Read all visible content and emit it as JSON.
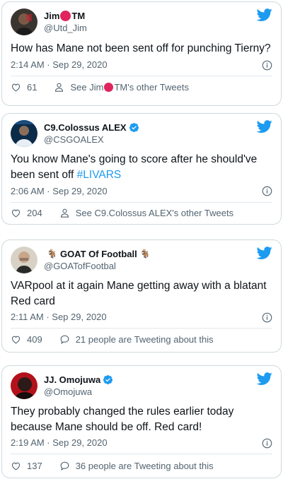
{
  "colors": {
    "twitter_blue": "#1d9bf0",
    "text_primary": "#0f1419",
    "text_secondary": "#536471",
    "border": "#cfd9de",
    "red_dot": "#e0245e"
  },
  "tweets": [
    {
      "name_part1": "Jim",
      "name_part2": "TM",
      "handle": "@Utd_Jim",
      "text": "How has Mane not been sent off for punching Tierny?",
      "timestamp": "2:14 AM · Sep 29, 2020",
      "like_count": "61",
      "more_link_part1": "See Jim",
      "more_link_part2": "TM's other Tweets",
      "icons": [
        "twitter-bird-icon",
        "info-icon",
        "heart-icon",
        "person-icon"
      ]
    },
    {
      "name": "C9.Colossus ALEX",
      "handle": "@CSGOALEX",
      "verified": true,
      "text_before_hashtag": "You know Mane's going to score after he should've been sent off ",
      "hashtag": "#LIVARS",
      "timestamp": "2:06 AM · Sep 29, 2020",
      "like_count": "204",
      "more_link": "See C9.Colossus ALEX's other Tweets",
      "icons": [
        "twitter-bird-icon",
        "verified-badge-icon",
        "info-icon",
        "heart-icon",
        "person-icon"
      ]
    },
    {
      "name": "GOAT Of Football",
      "name_prefix_emoji": "🐐",
      "name_suffix_emoji": "🐐",
      "handle": "@GOATofFootbal",
      "text": "VARpool at it again Mane getting away with a blatant Red card",
      "timestamp": "2:11 AM · Sep 29, 2020",
      "like_count": "409",
      "more_link": "21 people are Tweeting about this",
      "icons": [
        "twitter-bird-icon",
        "info-icon",
        "heart-icon",
        "speech-bubble-icon"
      ]
    },
    {
      "name": "JJ. Omojuwa",
      "handle": "@Omojuwa",
      "verified": true,
      "text": "They probably changed the rules earlier today because Mane should be off. Red card!",
      "timestamp": "2:19 AM · Sep 29, 2020",
      "like_count": "137",
      "more_link": "36 people are Tweeting about this",
      "icons": [
        "twitter-bird-icon",
        "verified-badge-icon",
        "info-icon",
        "heart-icon",
        "speech-bubble-icon"
      ]
    }
  ]
}
